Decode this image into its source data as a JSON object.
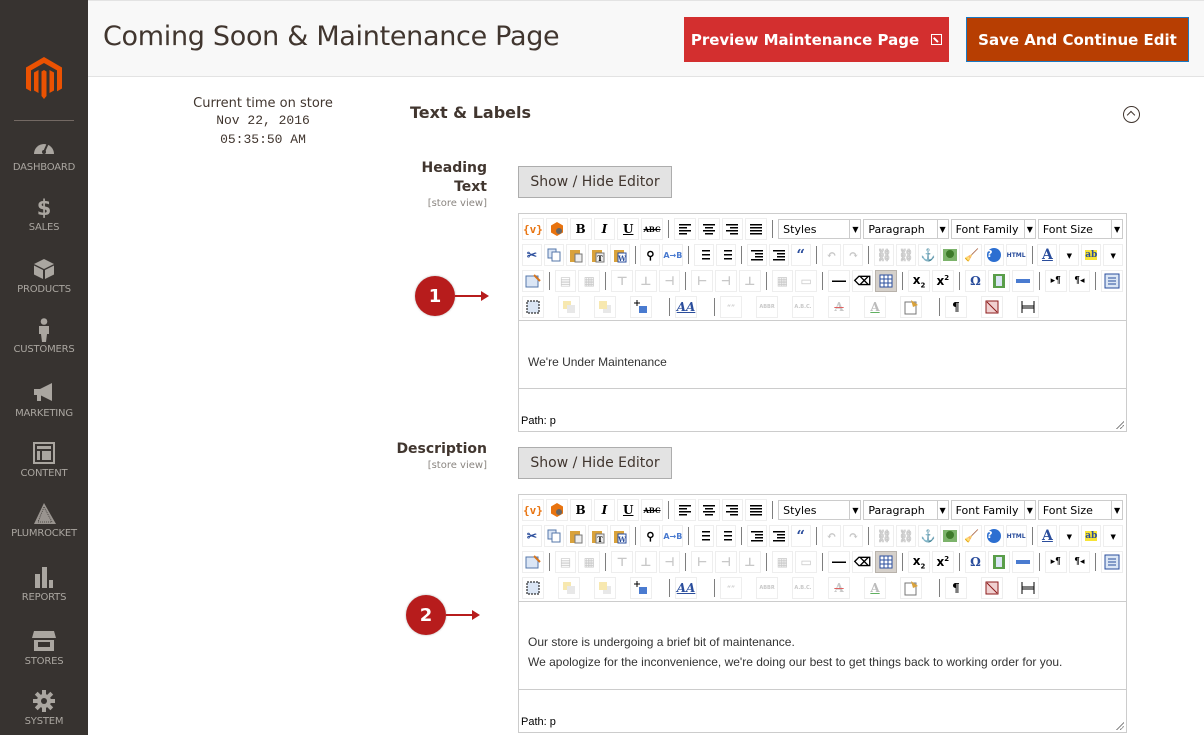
{
  "sidebar": {
    "logo": "magento-logo",
    "items": [
      {
        "label": "DASHBOARD",
        "icon": "dashboard-gauge-icon"
      },
      {
        "label": "SALES",
        "icon": "dollar-icon"
      },
      {
        "label": "PRODUCTS",
        "icon": "box-icon"
      },
      {
        "label": "CUSTOMERS",
        "icon": "person-icon"
      },
      {
        "label": "MARKETING",
        "icon": "megaphone-icon"
      },
      {
        "label": "CONTENT",
        "icon": "layout-icon"
      },
      {
        "label": "PLUMROCKET",
        "icon": "plumrocket-icon"
      },
      {
        "label": "REPORTS",
        "icon": "bar-chart-icon"
      },
      {
        "label": "STORES",
        "icon": "storefront-icon"
      },
      {
        "label": "SYSTEM",
        "icon": "gear-icon"
      }
    ]
  },
  "header": {
    "title": "Coming Soon & Maintenance Page",
    "preview_button": "Preview Maintenance Page",
    "save_button": "Save And Continue Edit"
  },
  "store_time": {
    "label": "Current time on store",
    "date": "Nov 22, 2016",
    "time": "05:35:50 AM"
  },
  "section": {
    "title": "Text & Labels"
  },
  "fields": [
    {
      "label_line1": "Heading",
      "label_line2": "Text",
      "scope": "[store view]",
      "toggle_button": "Show / Hide Editor",
      "content": [
        "We're Under Maintenance"
      ],
      "path": "Path: p",
      "callout": "1"
    },
    {
      "label_line1": "Description",
      "label_line2": "",
      "scope": "[store view]",
      "toggle_button": "Show / Hide Editor",
      "content": [
        "Our store is undergoing a brief bit of maintenance.",
        "We apologize for the inconvenience, we're doing our best to get things back to working order for you."
      ],
      "path": "Path: p",
      "callout": "2"
    }
  ],
  "toolbar": {
    "styles": "Styles",
    "format": "Paragraph",
    "font_family": "Font Family",
    "font_size": "Font Size",
    "bold": "B",
    "italic": "I",
    "underline": "U",
    "strike": "ABC",
    "html": "HTML",
    "abbr": "ABBR",
    "acronym": "A.B.C.",
    "cite": "“”",
    "omega": "Ω",
    "pilcrow": "¶"
  },
  "colors": {
    "sidebar_bg": "#373330",
    "brand_orange": "#eb5202",
    "preview_red": "#d32f2f",
    "save_orange": "#b73e02",
    "callout_red": "#b71c1c"
  }
}
